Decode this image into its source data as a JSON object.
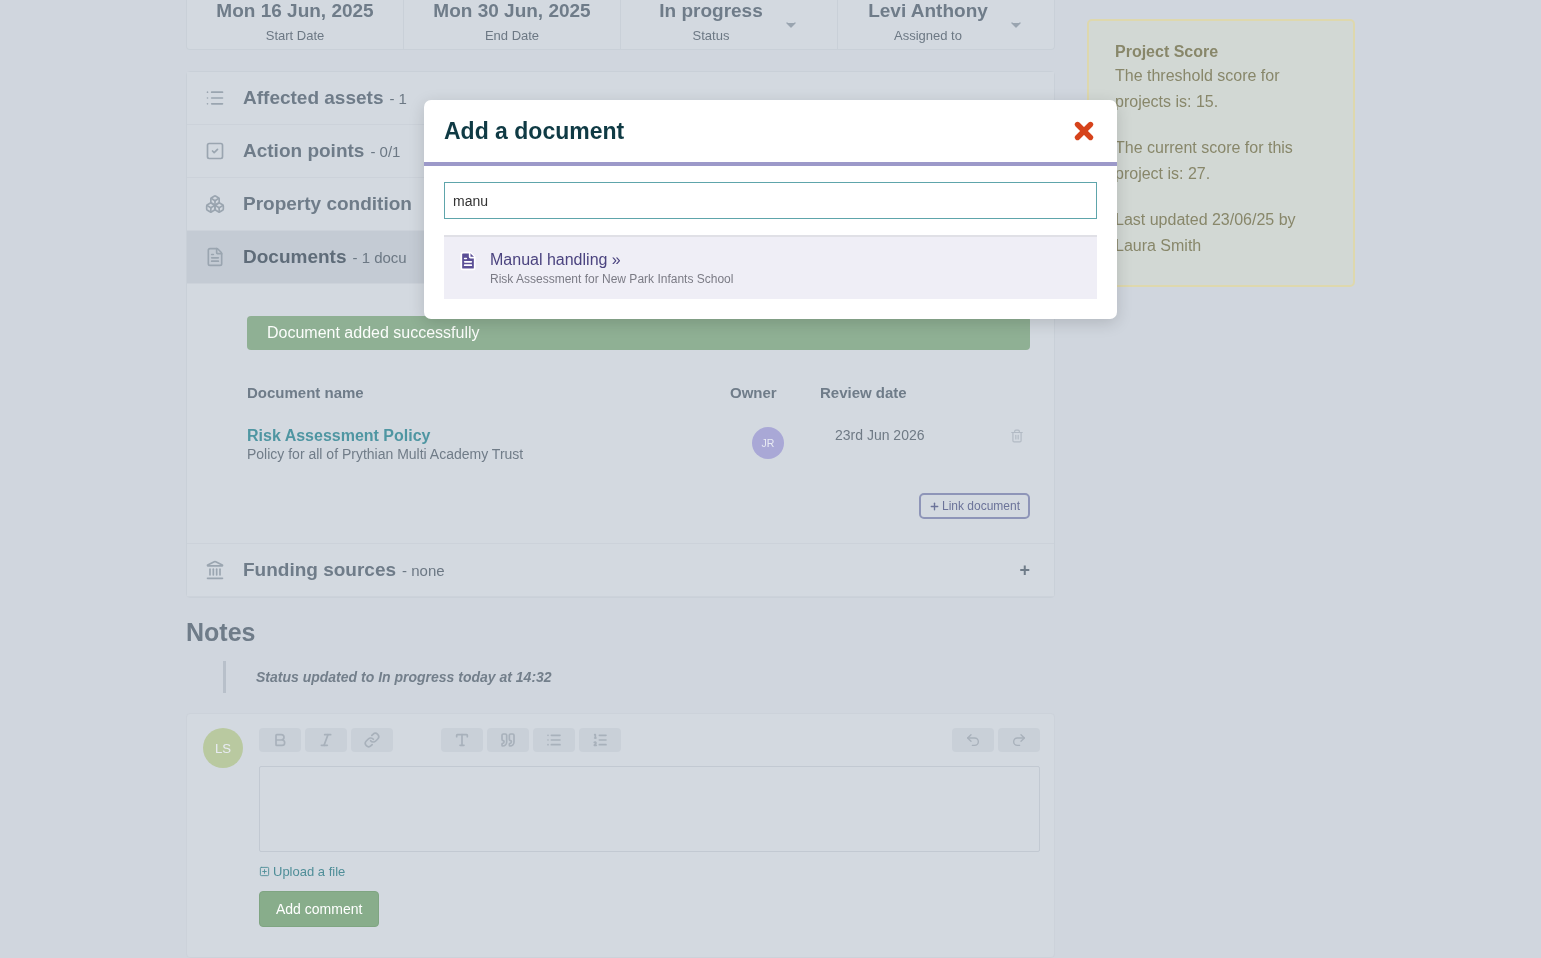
{
  "header_fields": [
    {
      "kind": "date",
      "value": "Mon 16 Jun, 2025",
      "label": "Start Date"
    },
    {
      "kind": "date",
      "value": "Mon 30 Jun, 2025",
      "label": "End Date"
    },
    {
      "kind": "select",
      "value": "In progress",
      "label": "Status"
    },
    {
      "kind": "select",
      "value": "Levi Anthony",
      "label": "Assigned to"
    }
  ],
  "sections": [
    {
      "kind": "list",
      "title": "Affected assets",
      "summary": "- 1",
      "expanded": false
    },
    {
      "kind": "check",
      "title": "Action points",
      "summary": "- 0/1",
      "expanded": false
    },
    {
      "kind": "cubes",
      "title": "Property condition",
      "expanded": false
    },
    {
      "kind": "file",
      "title": "Documents",
      "summary": "- 1 docu",
      "expanded": true
    },
    {
      "kind": "bank",
      "title": "Funding sources",
      "summary": "- none",
      "expanded": false,
      "toggle": "+"
    }
  ],
  "documents": {
    "alert": "Document added successfully",
    "columns": [
      "Document name",
      "Owner",
      "Review date"
    ],
    "rows": [
      {
        "name": "Risk Assessment Policy",
        "description": "Policy for all of Prythian Multi Academy Trust",
        "owner": "JR",
        "review_date": "23rd Jun 2026"
      }
    ],
    "link_button": "Link document"
  },
  "notes": {
    "title": "Notes",
    "entries": [
      "Status updated to **In progress** today at 14:32"
    ],
    "composer": {
      "avatar": "LS",
      "upload": "Upload a file",
      "submit": "Add comment"
    }
  },
  "score_card": {
    "title": "Project Score",
    "paragraphs": [
      "The threshold score for projects is: 15.",
      "The current score for this project is: 27.",
      "Last updated 23/06/25 by Laura Smith"
    ]
  },
  "modal": {
    "title": "Add a document",
    "search": {
      "value": "manu"
    },
    "results": [
      {
        "title": "Manual handling »",
        "subtitle": "Risk Assessment for New Park Infants School",
        "selected": true
      }
    ]
  }
}
